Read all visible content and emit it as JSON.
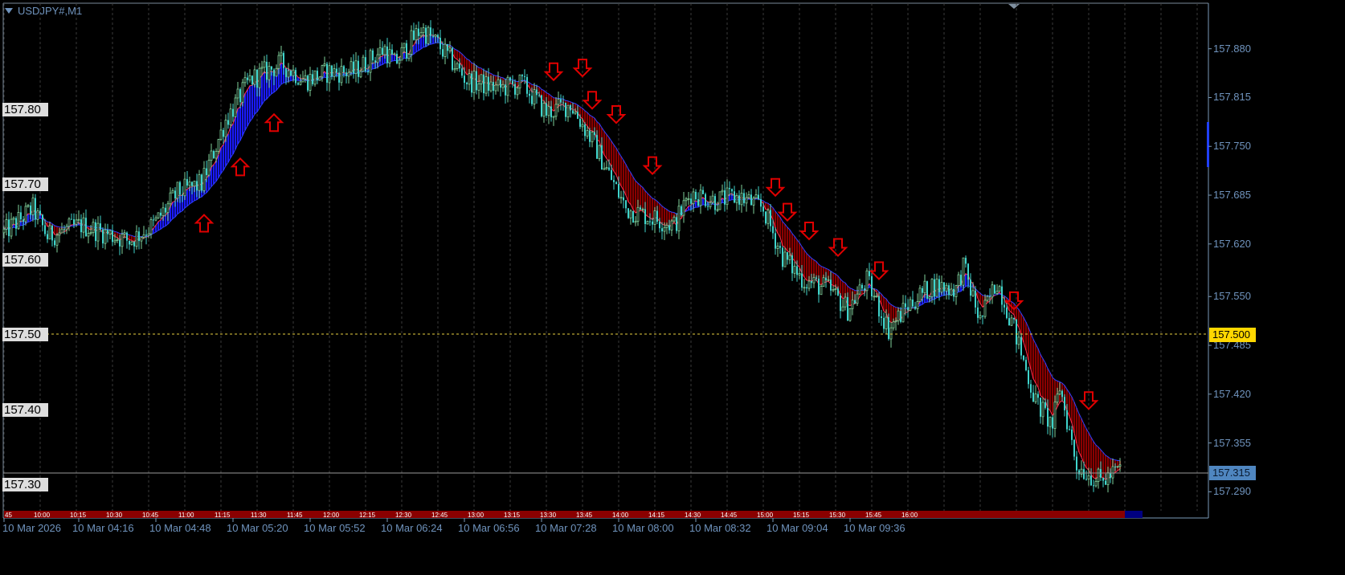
{
  "window": {
    "symbol_title": "USDJPY#,M1"
  },
  "colors": {
    "background": "#000000",
    "bull_candle": "#7fcf9a",
    "bear_candle": "#3fd4cc",
    "band_up": "#1a1aff",
    "band_down": "#8a0000",
    "arrow": "#e00000",
    "axis_text": "#6f93bd",
    "grid": "#3a3a3a",
    "level_line": "#e8d040",
    "price_line": "#9a9a9a"
  },
  "chart_data": {
    "type": "candlestick",
    "title": "USDJPY#,M1",
    "timeframe_minutes": 1,
    "ylim": [
      157.265,
      157.935
    ],
    "x_range_minutes": [
      0,
      499
    ],
    "grid": true,
    "price_path": [
      [
        0,
        157.635
      ],
      [
        12,
        157.667
      ],
      [
        18,
        157.63
      ],
      [
        32,
        157.645
      ],
      [
        52,
        157.624
      ],
      [
        62,
        157.645
      ],
      [
        72,
        157.688
      ],
      [
        82,
        157.7
      ],
      [
        92,
        157.785
      ],
      [
        102,
        157.838
      ],
      [
        115,
        157.86
      ],
      [
        125,
        157.838
      ],
      [
        135,
        157.849
      ],
      [
        145,
        157.849
      ],
      [
        158,
        157.88
      ],
      [
        162,
        157.86
      ],
      [
        173,
        157.907
      ],
      [
        180,
        157.886
      ],
      [
        192,
        157.838
      ],
      [
        205,
        157.827
      ],
      [
        215,
        157.833
      ],
      [
        225,
        157.795
      ],
      [
        235,
        157.806
      ],
      [
        245,
        157.752
      ],
      [
        258,
        157.667
      ],
      [
        268,
        157.656
      ],
      [
        278,
        157.645
      ],
      [
        285,
        157.688
      ],
      [
        295,
        157.678
      ],
      [
        305,
        157.683
      ],
      [
        315,
        157.667
      ],
      [
        323,
        157.603
      ],
      [
        332,
        157.571
      ],
      [
        342,
        157.56
      ],
      [
        350,
        157.533
      ],
      [
        358,
        157.571
      ],
      [
        367,
        157.506
      ],
      [
        375,
        157.538
      ],
      [
        385,
        157.565
      ],
      [
        395,
        157.56
      ],
      [
        398,
        157.59
      ],
      [
        405,
        157.517
      ],
      [
        412,
        157.571
      ],
      [
        418,
        157.517
      ],
      [
        428,
        157.41
      ],
      [
        435,
        157.378
      ],
      [
        438,
        157.43
      ],
      [
        445,
        157.325
      ],
      [
        455,
        157.303
      ],
      [
        463,
        157.32
      ]
    ],
    "signal_arrows": [
      {
        "minute": 83,
        "price": 157.647,
        "direction": "up"
      },
      {
        "minute": 98,
        "price": 157.722,
        "direction": "up"
      },
      {
        "minute": 112,
        "price": 157.781,
        "direction": "up"
      },
      {
        "minute": 228,
        "price": 157.85,
        "direction": "down"
      },
      {
        "minute": 240,
        "price": 157.855,
        "direction": "down"
      },
      {
        "minute": 244,
        "price": 157.812,
        "direction": "down"
      },
      {
        "minute": 254,
        "price": 157.793,
        "direction": "down"
      },
      {
        "minute": 269,
        "price": 157.725,
        "direction": "down"
      },
      {
        "minute": 320,
        "price": 157.696,
        "direction": "down"
      },
      {
        "minute": 325,
        "price": 157.663,
        "direction": "down"
      },
      {
        "minute": 334,
        "price": 157.638,
        "direction": "down"
      },
      {
        "minute": 346,
        "price": 157.616,
        "direction": "down"
      },
      {
        "minute": 363,
        "price": 157.585,
        "direction": "down"
      },
      {
        "minute": 419,
        "price": 157.545,
        "direction": "down"
      },
      {
        "minute": 450,
        "price": 157.412,
        "direction": "down"
      }
    ],
    "left_price_labels": [
      "157.80",
      "157.70",
      "157.60",
      "157.50",
      "157.40",
      "157.30"
    ],
    "left_price_values": [
      157.8,
      157.7,
      157.6,
      157.5,
      157.4,
      157.3
    ],
    "right_axis_ticks": [
      "157.880",
      "157.815",
      "157.750",
      "157.685",
      "157.620",
      "157.550",
      "157.485",
      "157.420",
      "157.355",
      "157.290"
    ],
    "right_axis_values": [
      157.88,
      157.815,
      157.75,
      157.685,
      157.62,
      157.55,
      157.485,
      157.42,
      157.355,
      157.29
    ],
    "level_line": {
      "price": 157.5,
      "label": "157.500"
    },
    "current_price": {
      "price": 157.315,
      "label": "157.315"
    },
    "time_axis": {
      "labels": [
        "10 Mar 2026",
        "10 Mar 04:16",
        "10 Mar 04:48",
        "10 Mar 05:20",
        "10 Mar 05:52",
        "10 Mar 06:24",
        "10 Mar 06:56",
        "10 Mar 07:28",
        "10 Mar 08:00",
        "10 Mar 08:32",
        "10 Mar 09:04",
        "10 Mar 09:36"
      ],
      "label_minutes": [
        0,
        31,
        63,
        95,
        127,
        159,
        191,
        223,
        255,
        287,
        319,
        351
      ]
    },
    "session_bar": {
      "labels": [
        "45",
        "10:00",
        "10:15",
        "10:30",
        "10:45",
        "11:00",
        "11:15",
        "11:30",
        "11:45",
        "12:00",
        "12:15",
        "12:30",
        "12:45",
        "13:00",
        "13:15",
        "13:30",
        "13:45",
        "14:00",
        "14:15",
        "14:30",
        "14:45",
        "15:00",
        "15:15",
        "15:30",
        "15:45",
        "16:00"
      ]
    }
  }
}
